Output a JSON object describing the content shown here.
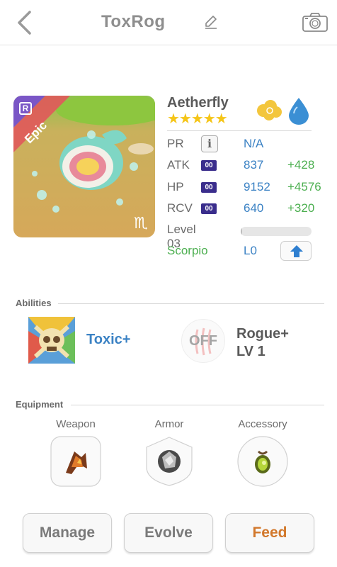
{
  "header": {
    "title": "ToxRog"
  },
  "pet": {
    "name": "Aetherfly",
    "stars": "★★★★★",
    "rarity": "Epic",
    "rarity_color": "#e05a5a",
    "corner_badge": "R",
    "zodiac_symbol": "♏",
    "elements": [
      "cloud-icon",
      "water-drop-icon"
    ]
  },
  "stats": {
    "pr": {
      "label": "PR",
      "value": "N/A"
    },
    "atk": {
      "label": "ATK",
      "badge": "00",
      "value": "837",
      "bonus": "+428"
    },
    "hp": {
      "label": "HP",
      "badge": "00",
      "value": "9152",
      "bonus": "+4576"
    },
    "rcv": {
      "label": "RCV",
      "badge": "00",
      "value": "640",
      "bonus": "+320"
    },
    "level": {
      "label": "Level 03",
      "progress": 0.02
    },
    "sign": {
      "label": "Scorpio",
      "value": "L0"
    }
  },
  "abilities": {
    "title": "Abilities",
    "primary": {
      "name": "Toxic+"
    },
    "secondary": {
      "state": "OFF",
      "name_line1": "Rogue+",
      "name_line2": "LV 1"
    }
  },
  "equipment": {
    "title": "Equipment",
    "slots": [
      {
        "label": "Weapon"
      },
      {
        "label": "Armor"
      },
      {
        "label": "Accessory"
      }
    ]
  },
  "actions": {
    "manage": "Manage",
    "evolve": "Evolve",
    "feed": "Feed"
  },
  "colors": {
    "accent_blue": "#3b82c4",
    "bonus_green": "#4caf50",
    "feed_orange": "#d2782c",
    "star_gold": "#f5c518",
    "badge_purple": "#3a2d8c"
  }
}
